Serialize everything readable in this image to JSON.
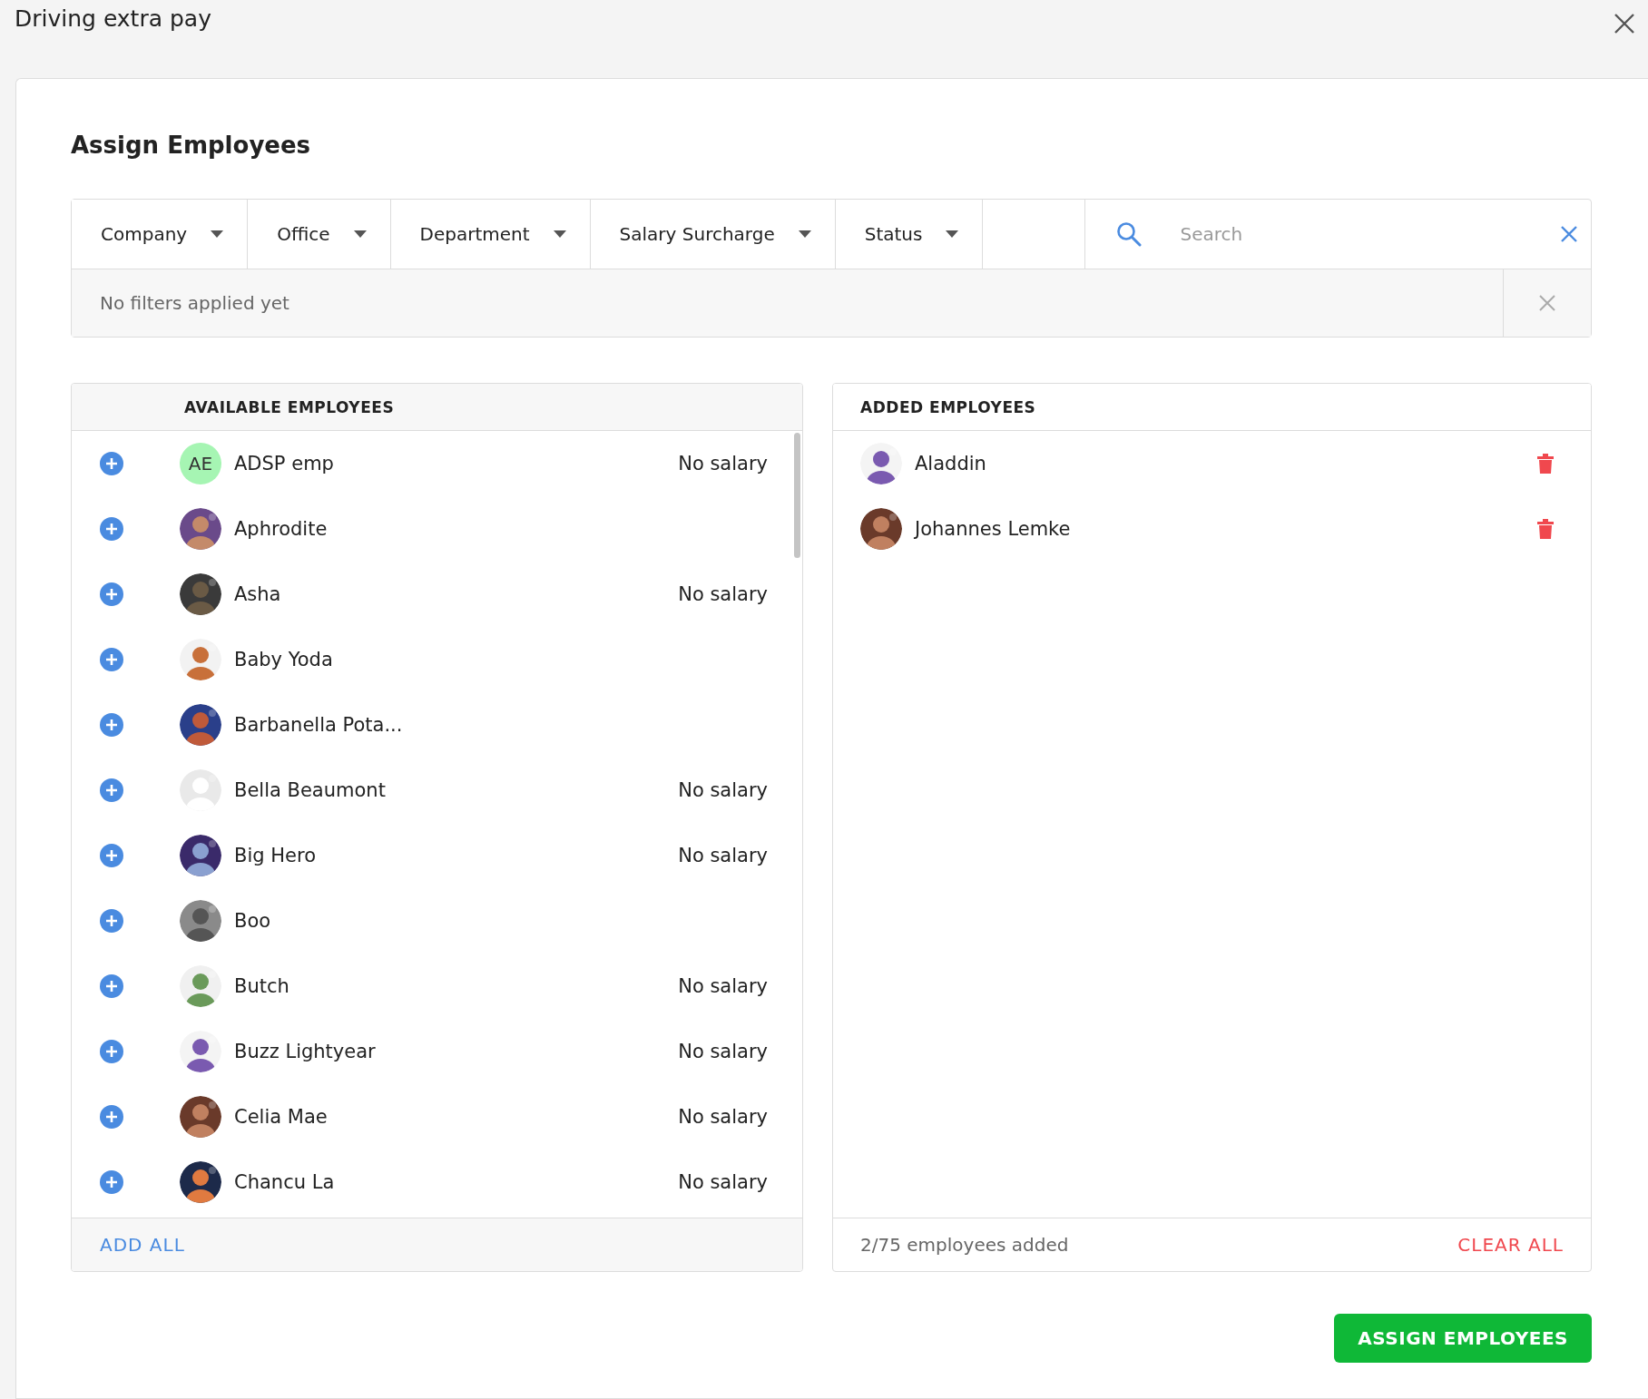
{
  "window": {
    "title": "Driving extra pay"
  },
  "heading": "Assign Employees",
  "filters": [
    {
      "label": "Company"
    },
    {
      "label": "Office"
    },
    {
      "label": "Department"
    },
    {
      "label": "Salary Surcharge"
    },
    {
      "label": "Status"
    }
  ],
  "search": {
    "placeholder": "Search"
  },
  "filter_summary": "No filters applied yet",
  "available": {
    "title": "AVAILABLE EMPLOYEES",
    "footer_action": "ADD ALL",
    "rows": [
      {
        "name": "ADSP emp",
        "avatar": {
          "kind": "initials",
          "text": "AE"
        },
        "salary": "No salary"
      },
      {
        "name": "Aphrodite"
      },
      {
        "name": "Asha",
        "salary": "No salary"
      },
      {
        "name": "Baby Yoda"
      },
      {
        "name": "Barbanella Pota..."
      },
      {
        "name": "Bella Beaumont",
        "salary": "No salary"
      },
      {
        "name": "Big Hero",
        "salary": "No salary"
      },
      {
        "name": "Boo"
      },
      {
        "name": "Butch",
        "salary": "No salary"
      },
      {
        "name": "Buzz Lightyear",
        "salary": "No salary"
      },
      {
        "name": "Celia Mae",
        "salary": "No salary"
      },
      {
        "name": "Chancu La",
        "salary": "No salary"
      }
    ]
  },
  "added": {
    "title": "ADDED EMPLOYEES",
    "count": "2/75 employees added",
    "footer_action": "CLEAR ALL",
    "rows": [
      {
        "name": "Aladdin"
      },
      {
        "name": "Johannes Lemke"
      }
    ]
  },
  "primary_button": "ASSIGN EMPLOYEES"
}
